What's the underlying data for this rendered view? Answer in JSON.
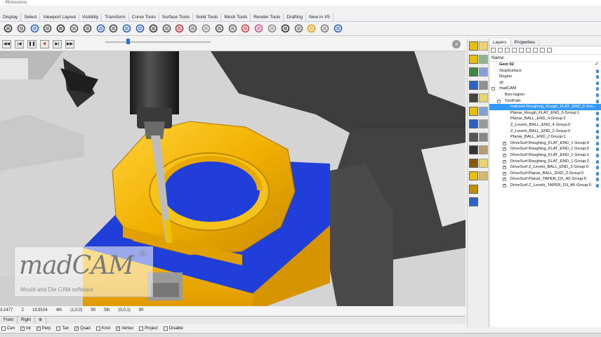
{
  "window": {
    "title": "- Rhinoceros"
  },
  "tabs": [
    "Display",
    "Select",
    "Viewport Layout",
    "Visibility",
    "Transform",
    "Curve Tools",
    "Surface Tools",
    "Solid Tools",
    "Mesh Tools",
    "Render Tools",
    "Drafting",
    "New in V5"
  ],
  "toolbar_icons": [
    "new-file-icon",
    "open-icon",
    "save-icon",
    "print-icon",
    "undo-icon",
    "pan-icon",
    "move-icon",
    "zoom-icon",
    "zoom-window-icon",
    "zoom-extents-icon",
    "zoom-selected-icon",
    "rotate-icon",
    "grid-icon",
    "cplane-icon",
    "layer-icon",
    "light-icon",
    "properties-icon",
    "lock-icon",
    "render-icon",
    "color-wheel-icon",
    "sphere-icon",
    "shaded-icon",
    "rendered-icon",
    "analysis-icon",
    "options-icon",
    "help-icon"
  ],
  "animation": {
    "buttons": [
      "previous-icon",
      "rewind-icon",
      "pause-icon",
      "stop-icon",
      "step-icon",
      "play-icon"
    ],
    "progress": 0.2
  },
  "viewport": {
    "close_label": "×",
    "watermark_text": "madCAM",
    "watermark_sub": "Mould and Die CAM software",
    "registered": "®"
  },
  "coords": {
    "x": "3.2477",
    "z_label": "Z",
    "z": "19.9104",
    "a4_label": "4th",
    "a4": "(1,0,0)",
    "a4_val": "90",
    "a5_label": "5th",
    "a5": "(0,0,1)",
    "a5_val": "90"
  },
  "viewtabs": [
    "Front",
    "Right",
    "⊕"
  ],
  "osnap": [
    {
      "label": "Cen",
      "checked": false
    },
    {
      "label": "Int",
      "checked": true
    },
    {
      "label": "Perp",
      "checked": true
    },
    {
      "label": "Tan",
      "checked": false
    },
    {
      "label": "Quad",
      "checked": true
    },
    {
      "label": "Knot",
      "checked": false
    },
    {
      "label": "Vertex",
      "checked": true
    },
    {
      "label": "Project",
      "checked": false
    },
    {
      "label": "Disable",
      "checked": false
    }
  ],
  "layers": {
    "tab_layers": "Layers",
    "tab_properties": "Properties",
    "column_header": "Name",
    "rows": [
      {
        "label": "Gem 02",
        "indent": 0,
        "bold": true,
        "check": true
      },
      {
        "label": "StopSurface",
        "indent": 0
      },
      {
        "label": "Region",
        "indent": 0
      },
      {
        "label": "stl",
        "indent": 0
      },
      {
        "label": "madCAM",
        "indent": 0,
        "expander": "−"
      },
      {
        "label": "Box-region",
        "indent": 1
      },
      {
        "label": "ToolPath",
        "indent": 1,
        "expander": "−"
      },
      {
        "label": "Indexed Roughing_Rough_FLAT_END_6 Gro...",
        "indent": 2,
        "selected": true
      },
      {
        "label": "Planar_Rough_FLAT_END_6 Group:1",
        "indent": 2
      },
      {
        "label": "Planar_BALL_END_4 Group:2",
        "indent": 2
      },
      {
        "label": "Z_Levels_BALL_END_4 Group:0",
        "indent": 2
      },
      {
        "label": "Z_Levels_BALL_END_2 Group:0",
        "indent": 2
      },
      {
        "label": "Planar_BALL_END_2 Group:1",
        "indent": 2
      },
      {
        "label": "DriveSurf Roughing_FLAT_END_1 Group:4",
        "indent": 2,
        "expander": "+"
      },
      {
        "label": "DriveSurf Roughing_FLAT_END_1 Group:0",
        "indent": 2,
        "expander": "+"
      },
      {
        "label": "DriveSurf Roughing_FLAT_END_1 Group:1",
        "indent": 2,
        "expander": "+"
      },
      {
        "label": "DriveSurf Roughing_FLAT_END_1 Group:2",
        "indent": 2,
        "expander": "+"
      },
      {
        "label": "DriveSurf Z_Levels_BALL_END_3 Group:0",
        "indent": 2,
        "expander": "+"
      },
      {
        "label": "DriveSurf Planar_BALL_END_3 Group:0",
        "indent": 2,
        "expander": "+"
      },
      {
        "label": "DriveSurf Planar_TAPER_D3_A5 Group:0",
        "indent": 2,
        "expander": "+"
      },
      {
        "label": "DriveSurf Z_Levels_TAPER_D3_A5 Group:0",
        "indent": 2,
        "expander": "+"
      }
    ]
  },
  "colors": {
    "part_gold": "#f2b000",
    "stock_blue": "#1f3fd8",
    "spindle": "#2b2b2b",
    "selection": "#3399ff",
    "bulb": "#3c8ee0"
  }
}
